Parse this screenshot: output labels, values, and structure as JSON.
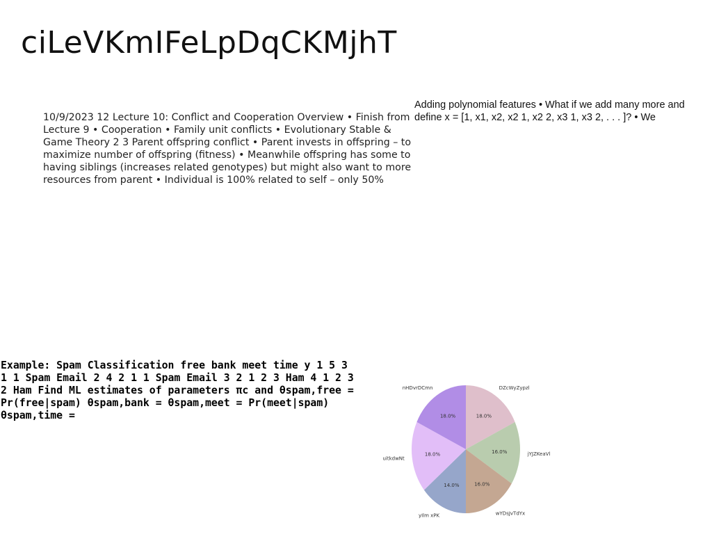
{
  "page": {
    "title": "ciLeVKmIFeLpDqCKMjhT",
    "lecture_text": "10/9/2023 12 Lecture 10: Conflict and Cooperation Overview • Finish from Lecture 9 • Cooperation • Family unit conflicts • Evolutionary Stable & Game Theory 2 3 Parent offspring conflict • Parent invests in offspring – to maximize number of offspring (fitness) • Meanwhile offspring has some to having siblings (increases related genotypes) but might also want to more resources from parent • Individual is 100% related to self – only 50%",
    "poly_text": "Adding polynomial features • What if we add many more and define x = [1, x1, x2, x2 1, x2 2, x3 1, x3 2, . . . ]? • We",
    "spam_text": "Example: Spam Classification free bank meet time y 1 5 3 1 1 Spam Email 2 4 2 1 1 Spam Email 3 2 1 2 3 Ham 4 1 2 3 2 Ham Find ML estimates of parameters πc and θspam,free = Pr(free|spam) θspam,bank = θspam,meet = Pr(meet|spam) θspam,time ="
  },
  "chart_data": {
    "type": "pie",
    "start_angle_deg": 90,
    "direction": "clockwise",
    "slices": [
      {
        "label": "DZcWyZypzl",
        "value": 18.0,
        "pct_label": "18.0%",
        "color": "#dfbfcb"
      },
      {
        "label": "jYJZKeaVl",
        "value": 16.0,
        "pct_label": "16.0%",
        "color": "#b9ccae"
      },
      {
        "label": "wYDsJvTdYx",
        "value": 16.0,
        "pct_label": "16.0%",
        "color": "#c4a792"
      },
      {
        "label": "yIlm xPK",
        "value": 14.0,
        "pct_label": "14.0%",
        "color": "#96a6ca"
      },
      {
        "label": "uitkdwNt",
        "value": 18.0,
        "pct_label": "18.0%",
        "color": "#e2bef8"
      },
      {
        "label": "nHDvrDCmn",
        "value": 18.0,
        "pct_label": "18.0%",
        "color": "#b18de6"
      }
    ]
  }
}
